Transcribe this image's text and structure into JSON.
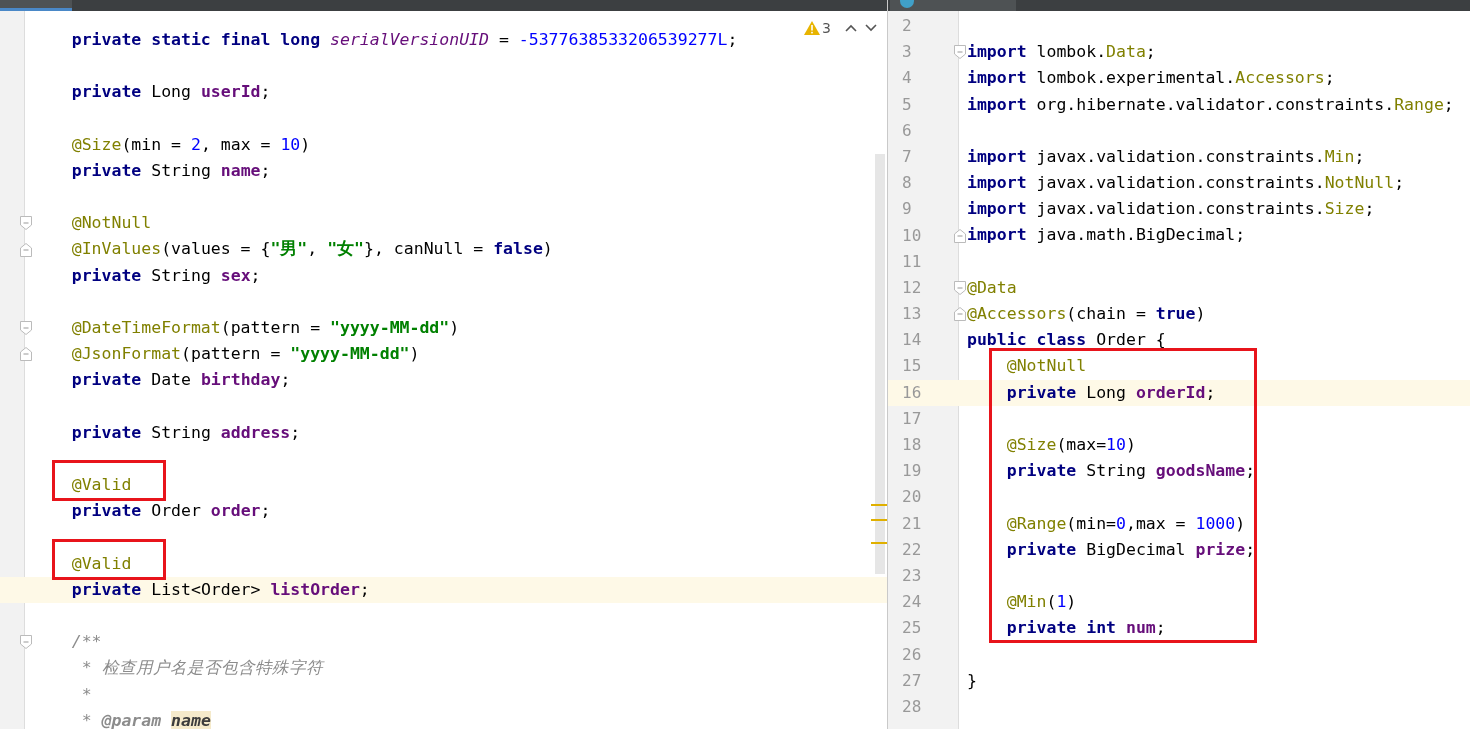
{
  "left_editor": {
    "tab": {
      "selected": true
    },
    "warnings": {
      "count": "3"
    },
    "blocks": [
      {
        "boxed": false,
        "lines": [
          {
            "kind": "code",
            "indented": true,
            "tokens": [
              {
                "kind": "kw",
                "text": "private static final long "
              },
              {
                "kind": "static",
                "text": "serialVersionUID"
              },
              {
                "kind": "plain",
                "text": " = "
              },
              {
                "kind": "num",
                "text": "-5377638533206539277L"
              },
              {
                "kind": "plain",
                "text": ";"
              }
            ]
          },
          {
            "kind": "blank"
          },
          {
            "kind": "code",
            "indented": true,
            "tokens": [
              {
                "kind": "kw",
                "text": "private"
              },
              {
                "kind": "plain",
                "text": " Long "
              },
              {
                "kind": "field",
                "text": "userId"
              },
              {
                "kind": "plain",
                "text": ";"
              }
            ]
          },
          {
            "kind": "blank"
          },
          {
            "kind": "code",
            "indented": true,
            "tokens": [
              {
                "kind": "anno",
                "text": "@Size"
              },
              {
                "kind": "plain",
                "text": "(min = "
              },
              {
                "kind": "num",
                "text": "2"
              },
              {
                "kind": "plain",
                "text": ", max = "
              },
              {
                "kind": "num",
                "text": "10"
              },
              {
                "kind": "plain",
                "text": ")"
              }
            ]
          },
          {
            "kind": "code",
            "indented": true,
            "tokens": [
              {
                "kind": "kw",
                "text": "private"
              },
              {
                "kind": "plain",
                "text": " String "
              },
              {
                "kind": "field",
                "text": "name"
              },
              {
                "kind": "plain",
                "text": ";"
              }
            ]
          },
          {
            "kind": "blank"
          },
          {
            "kind": "code",
            "indented": true,
            "fold_start": true,
            "tokens": [
              {
                "kind": "anno",
                "text": "@NotNull"
              }
            ]
          },
          {
            "kind": "code",
            "indented": true,
            "fold_end": true,
            "tokens": [
              {
                "kind": "anno",
                "text": "@InValues"
              },
              {
                "kind": "plain",
                "text": "(values = {"
              },
              {
                "kind": "str",
                "text": "\"男\""
              },
              {
                "kind": "plain",
                "text": ", "
              },
              {
                "kind": "str",
                "text": "\"女\""
              },
              {
                "kind": "plain",
                "text": "}, canNull = "
              },
              {
                "kind": "kw",
                "text": "false"
              },
              {
                "kind": "plain",
                "text": ")"
              }
            ]
          },
          {
            "kind": "code",
            "indented": true,
            "tokens": [
              {
                "kind": "kw",
                "text": "private"
              },
              {
                "kind": "plain",
                "text": " String "
              },
              {
                "kind": "field",
                "text": "sex"
              },
              {
                "kind": "plain",
                "text": ";"
              }
            ]
          },
          {
            "kind": "blank"
          },
          {
            "kind": "code",
            "indented": true,
            "fold_start": true,
            "tokens": [
              {
                "kind": "anno",
                "text": "@DateTimeFormat"
              },
              {
                "kind": "plain",
                "text": "(pattern = "
              },
              {
                "kind": "str",
                "text": "\"yyyy-MM-dd\""
              },
              {
                "kind": "plain",
                "text": ")"
              }
            ]
          },
          {
            "kind": "code",
            "indented": true,
            "fold_end": true,
            "tokens": [
              {
                "kind": "anno",
                "text": "@JsonFormat"
              },
              {
                "kind": "plain",
                "text": "(pattern = "
              },
              {
                "kind": "str",
                "text": "\"yyyy-MM-dd\""
              },
              {
                "kind": "plain",
                "text": ")"
              }
            ]
          },
          {
            "kind": "code",
            "indented": true,
            "tokens": [
              {
                "kind": "kw",
                "text": "private"
              },
              {
                "kind": "plain",
                "text": " Date "
              },
              {
                "kind": "field",
                "text": "birthday"
              },
              {
                "kind": "plain",
                "text": ";"
              }
            ]
          },
          {
            "kind": "blank"
          },
          {
            "kind": "code",
            "indented": true,
            "tokens": [
              {
                "kind": "kw",
                "text": "private"
              },
              {
                "kind": "plain",
                "text": " String "
              },
              {
                "kind": "field",
                "text": "address"
              },
              {
                "kind": "plain",
                "text": ";"
              }
            ]
          },
          {
            "kind": "blank"
          }
        ]
      },
      {
        "boxed": true,
        "lines": [
          {
            "kind": "code",
            "indented": true,
            "tokens": [
              {
                "kind": "anno",
                "text": "@Valid"
              }
            ]
          }
        ]
      },
      {
        "boxed": false,
        "lines": [
          {
            "kind": "code",
            "indented": true,
            "tokens": [
              {
                "kind": "kw",
                "text": "private"
              },
              {
                "kind": "plain",
                "text": " Order "
              },
              {
                "kind": "field",
                "text": "order"
              },
              {
                "kind": "plain",
                "text": ";"
              }
            ]
          },
          {
            "kind": "blank"
          }
        ]
      },
      {
        "boxed": true,
        "lines": [
          {
            "kind": "code",
            "indented": true,
            "tokens": [
              {
                "kind": "anno",
                "text": "@Valid"
              }
            ]
          }
        ]
      },
      {
        "boxed": false,
        "lines": [
          {
            "kind": "code",
            "indented": true,
            "current": true,
            "tokens": [
              {
                "kind": "kw",
                "text": "private"
              },
              {
                "kind": "plain",
                "text": " List<Order> "
              },
              {
                "kind": "field",
                "text": "listOrder"
              },
              {
                "kind": "plain",
                "text": ";"
              }
            ]
          },
          {
            "kind": "blank"
          },
          {
            "kind": "code",
            "indented": true,
            "fold_start": true,
            "tokens": [
              {
                "kind": "doc",
                "text": "/**"
              }
            ]
          },
          {
            "kind": "code",
            "indented": true,
            "tokens": [
              {
                "kind": "doc",
                "text": " * 检查用户名是否包含特殊字符"
              }
            ]
          },
          {
            "kind": "code",
            "indented": true,
            "tokens": [
              {
                "kind": "doc",
                "text": " *"
              }
            ]
          },
          {
            "kind": "code",
            "indented": true,
            "tokens": [
              {
                "kind": "doc",
                "text": " * "
              },
              {
                "kind": "doctag",
                "text": "@param"
              },
              {
                "kind": "param",
                "text": "name"
              }
            ]
          }
        ]
      }
    ]
  },
  "right_editor": {
    "tab": {
      "selected": false
    },
    "blocks": [
      {
        "boxed": false,
        "lines": [
          {
            "kind": "blank",
            "number": "2"
          },
          {
            "kind": "code",
            "number": "3",
            "fold_start": true,
            "tokens": [
              {
                "kind": "kw",
                "text": "import"
              },
              {
                "kind": "plain",
                "text": " lombok."
              },
              {
                "kind": "anno",
                "text": "Data"
              },
              {
                "kind": "plain",
                "text": ";"
              }
            ]
          },
          {
            "kind": "code",
            "number": "4",
            "tokens": [
              {
                "kind": "kw",
                "text": "import"
              },
              {
                "kind": "plain",
                "text": " lombok.experimental."
              },
              {
                "kind": "anno",
                "text": "Accessors"
              },
              {
                "kind": "plain",
                "text": ";"
              }
            ]
          },
          {
            "kind": "code",
            "number": "5",
            "tokens": [
              {
                "kind": "kw",
                "text": "import"
              },
              {
                "kind": "plain",
                "text": " org.hibernate.validator.constraints."
              },
              {
                "kind": "anno",
                "text": "Range"
              },
              {
                "kind": "plain",
                "text": ";"
              }
            ]
          },
          {
            "kind": "blank",
            "number": "6"
          },
          {
            "kind": "code",
            "number": "7",
            "tokens": [
              {
                "kind": "kw",
                "text": "import"
              },
              {
                "kind": "plain",
                "text": " javax.validation.constraints."
              },
              {
                "kind": "anno",
                "text": "Min"
              },
              {
                "kind": "plain",
                "text": ";"
              }
            ]
          },
          {
            "kind": "code",
            "number": "8",
            "tokens": [
              {
                "kind": "kw",
                "text": "import"
              },
              {
                "kind": "plain",
                "text": " javax.validation.constraints."
              },
              {
                "kind": "anno",
                "text": "NotNull"
              },
              {
                "kind": "plain",
                "text": ";"
              }
            ]
          },
          {
            "kind": "code",
            "number": "9",
            "tokens": [
              {
                "kind": "kw",
                "text": "import"
              },
              {
                "kind": "plain",
                "text": " javax.validation.constraints."
              },
              {
                "kind": "anno",
                "text": "Size"
              },
              {
                "kind": "plain",
                "text": ";"
              }
            ]
          },
          {
            "kind": "code",
            "number": "10",
            "fold_end": true,
            "tokens": [
              {
                "kind": "kw",
                "text": "import"
              },
              {
                "kind": "plain",
                "text": " java.math.BigDecimal;"
              }
            ]
          },
          {
            "kind": "blank",
            "number": "11"
          },
          {
            "kind": "code",
            "number": "12",
            "fold_start": true,
            "tokens": [
              {
                "kind": "anno",
                "text": "@Data"
              }
            ]
          },
          {
            "kind": "code",
            "number": "13",
            "fold_end": true,
            "tokens": [
              {
                "kind": "anno",
                "text": "@Accessors"
              },
              {
                "kind": "plain",
                "text": "(chain = "
              },
              {
                "kind": "kw",
                "text": "true"
              },
              {
                "kind": "plain",
                "text": ")"
              }
            ]
          },
          {
            "kind": "code",
            "number": "14",
            "tokens": [
              {
                "kind": "kw",
                "text": "public class"
              },
              {
                "kind": "plain",
                "text": " Order {"
              }
            ]
          }
        ]
      },
      {
        "boxed": true,
        "lines": [
          {
            "kind": "code",
            "number": "15",
            "indented": true,
            "tokens": [
              {
                "kind": "anno",
                "text": "@NotNull"
              }
            ]
          },
          {
            "kind": "code",
            "number": "16",
            "indented": true,
            "current": true,
            "tokens": [
              {
                "kind": "kw",
                "text": "private"
              },
              {
                "kind": "plain",
                "text": " Long "
              },
              {
                "kind": "field",
                "text": "orderId"
              },
              {
                "kind": "plain",
                "text": ";"
              }
            ]
          },
          {
            "kind": "blank",
            "number": "17"
          },
          {
            "kind": "code",
            "number": "18",
            "indented": true,
            "tokens": [
              {
                "kind": "anno",
                "text": "@Size"
              },
              {
                "kind": "plain",
                "text": "(max="
              },
              {
                "kind": "num",
                "text": "10"
              },
              {
                "kind": "plain",
                "text": ")"
              }
            ]
          },
          {
            "kind": "code",
            "number": "19",
            "indented": true,
            "tokens": [
              {
                "kind": "kw",
                "text": "private"
              },
              {
                "kind": "plain",
                "text": " String "
              },
              {
                "kind": "field",
                "text": "goodsName"
              },
              {
                "kind": "plain",
                "text": ";"
              }
            ]
          },
          {
            "kind": "blank",
            "number": "20"
          },
          {
            "kind": "code",
            "number": "21",
            "indented": true,
            "tokens": [
              {
                "kind": "anno",
                "text": "@Range"
              },
              {
                "kind": "plain",
                "text": "(min="
              },
              {
                "kind": "num",
                "text": "0"
              },
              {
                "kind": "plain",
                "text": ",max = "
              },
              {
                "kind": "num",
                "text": "1000"
              },
              {
                "kind": "plain",
                "text": ")"
              }
            ]
          },
          {
            "kind": "code",
            "number": "22",
            "indented": true,
            "tokens": [
              {
                "kind": "kw",
                "text": "private"
              },
              {
                "kind": "plain",
                "text": " BigDecimal "
              },
              {
                "kind": "field",
                "text": "prize"
              },
              {
                "kind": "plain",
                "text": ";"
              }
            ]
          },
          {
            "kind": "blank",
            "number": "23"
          },
          {
            "kind": "code",
            "number": "24",
            "indented": true,
            "tokens": [
              {
                "kind": "anno",
                "text": "@Min"
              },
              {
                "kind": "plain",
                "text": "("
              },
              {
                "kind": "num",
                "text": "1"
              },
              {
                "kind": "plain",
                "text": ")"
              }
            ]
          },
          {
            "kind": "code",
            "number": "25",
            "indented": true,
            "tokens": [
              {
                "kind": "kw",
                "text": "private int "
              },
              {
                "kind": "field",
                "text": "num"
              },
              {
                "kind": "plain",
                "text": ";"
              }
            ]
          }
        ]
      },
      {
        "boxed": false,
        "lines": [
          {
            "kind": "blank",
            "number": "26"
          },
          {
            "kind": "code",
            "number": "27",
            "tokens": [
              {
                "kind": "plain",
                "text": "}"
              }
            ]
          },
          {
            "kind": "blank",
            "number": "28"
          }
        ]
      }
    ]
  }
}
